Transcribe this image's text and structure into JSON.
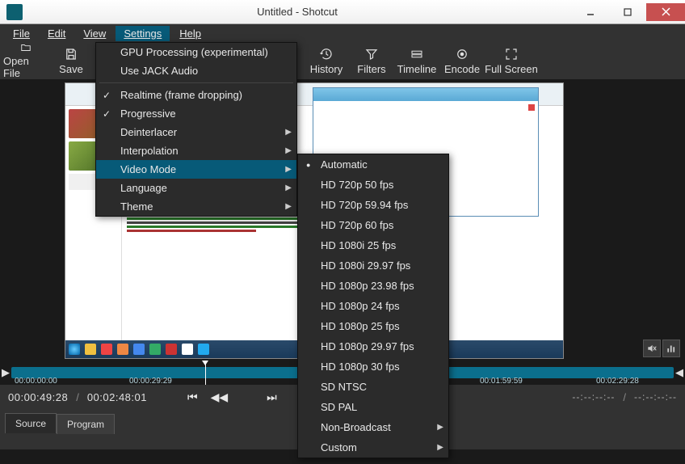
{
  "titlebar": {
    "title": "Untitled - Shotcut"
  },
  "menubar": {
    "file": "File",
    "edit": "Edit",
    "view": "View",
    "settings": "Settings",
    "help": "Help"
  },
  "toolbar": {
    "open_file": "Open File",
    "save": "Save",
    "history": "History",
    "filters": "Filters",
    "timeline": "Timeline",
    "encode": "Encode",
    "full_screen": "Full Screen"
  },
  "settings_menu": {
    "gpu": "GPU Processing (experimental)",
    "jack": "Use JACK Audio",
    "realtime": "Realtime (frame dropping)",
    "progressive": "Progressive",
    "deinterlacer": "Deinterlacer",
    "interpolation": "Interpolation",
    "video_mode": "Video Mode",
    "language": "Language",
    "theme": "Theme"
  },
  "video_mode_menu": {
    "automatic": "Automatic",
    "hd720p50": "HD 720p 50 fps",
    "hd720p5994": "HD 720p 59.94 fps",
    "hd720p60": "HD 720p 60 fps",
    "hd1080i25": "HD 1080i 25 fps",
    "hd1080i2997": "HD 1080i 29.97 fps",
    "hd1080p2398": "HD 1080p 23.98 fps",
    "hd1080p24": "HD 1080p 24 fps",
    "hd1080p25": "HD 1080p 25 fps",
    "hd1080p2997": "HD 1080p 29.97 fps",
    "hd1080p30": "HD 1080p 30 fps",
    "sdntsc": "SD NTSC",
    "sdpal": "SD PAL",
    "nonbroadcast": "Non-Broadcast",
    "custom": "Custom"
  },
  "timeline": {
    "tc0": "00:00:00:00",
    "tc1": "00:00:29:29",
    "tc2": "00:01:59:59",
    "tc3": "00:02:29:28"
  },
  "transport": {
    "current": "00:00:49:28",
    "total": "00:02:48:01",
    "dashes1": "--:--:--:--",
    "slash": "/",
    "dashes2": "--:--:--:--"
  },
  "tabs": {
    "source": "Source",
    "program": "Program"
  }
}
